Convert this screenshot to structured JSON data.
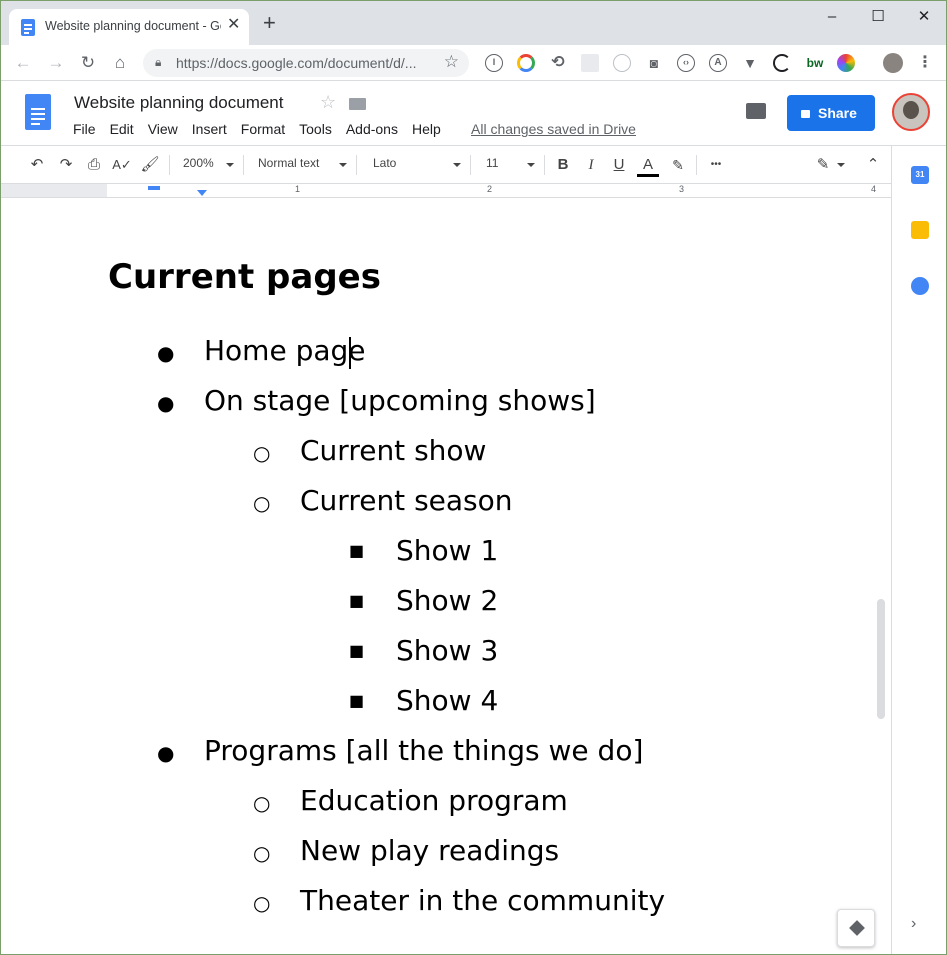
{
  "browser": {
    "tab_title": "Website planning document - Go",
    "tab_close": "✕",
    "new_tab": "+",
    "window_controls": {
      "minimize": "–",
      "maximize": "☐",
      "close": "✕"
    },
    "url": "https://docs.google.com/document/d/...",
    "nav_icons": [
      "back-arrow-icon",
      "forward-arrow-icon",
      "reload-icon",
      "home-icon"
    ],
    "extensions": [
      "1password-icon",
      "color-icon",
      "sync-icon",
      "grid-icon",
      "target-icon",
      "camera-icon",
      "code-icon",
      "a-circle-icon",
      "v-icon",
      "g-icon",
      "bw-icon",
      "colorwheel-icon",
      "profile-icon",
      "more-icon"
    ],
    "ext_bw": "bw"
  },
  "docs": {
    "title": "Website planning document",
    "menus": [
      "File",
      "Edit",
      "View",
      "Insert",
      "Format",
      "Tools",
      "Add-ons",
      "Help"
    ],
    "saved_status": "All changes saved in Drive",
    "share_label": "Share",
    "brand_color": "#1a73e8"
  },
  "toolbar": {
    "zoom": "200%",
    "style": "Normal text",
    "font": "Lato",
    "font_size": "11",
    "bold": "B",
    "italic": "I",
    "underline": "U",
    "text_color": "A",
    "more": "•••"
  },
  "ruler": {
    "labels": [
      "1",
      "2",
      "3",
      "4"
    ]
  },
  "sidepanel": {
    "calendar": "31"
  },
  "document": {
    "heading": "Current pages",
    "items": [
      {
        "level": 1,
        "text": "Home page"
      },
      {
        "level": 1,
        "text": "On stage [upcoming shows]"
      },
      {
        "level": 2,
        "text": "Current show"
      },
      {
        "level": 2,
        "text": "Current season"
      },
      {
        "level": 3,
        "text": "Show 1"
      },
      {
        "level": 3,
        "text": "Show 2"
      },
      {
        "level": 3,
        "text": "Show 3"
      },
      {
        "level": 3,
        "text": "Show 4"
      },
      {
        "level": 1,
        "text": "Programs [all the things we do]"
      },
      {
        "level": 2,
        "text": "Education program"
      },
      {
        "level": 2,
        "text": "New play readings"
      },
      {
        "level": 2,
        "text": "Theater in the community"
      }
    ],
    "bullets": {
      "1": "●",
      "2": "○",
      "3": "■"
    }
  }
}
